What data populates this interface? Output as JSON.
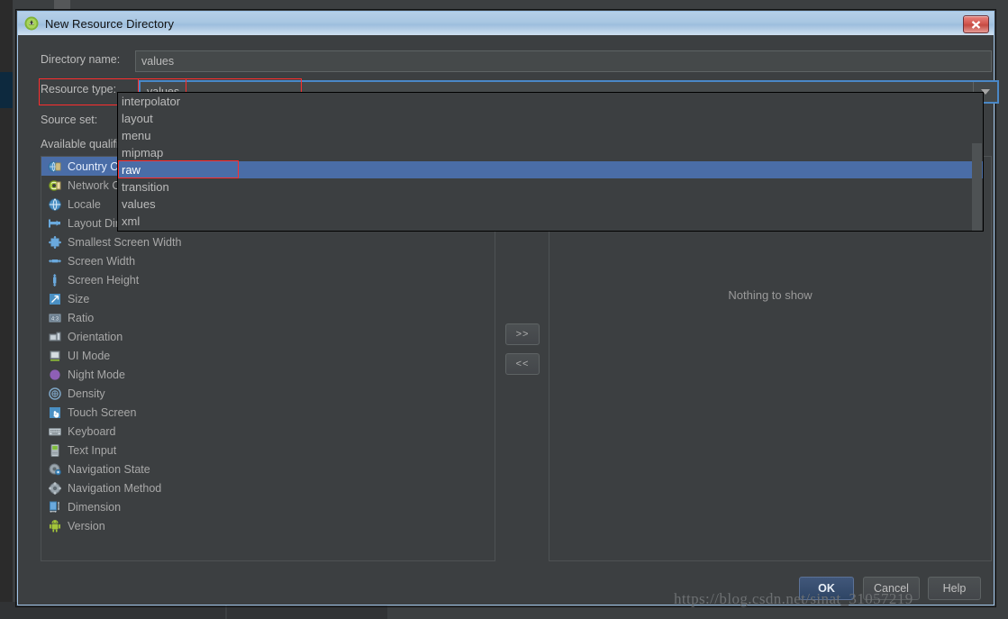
{
  "window": {
    "title": "New Resource Directory",
    "icon": "android-studio-icon",
    "close_label": "×"
  },
  "form": {
    "directory_name": {
      "label": "Directory name:",
      "value": "values"
    },
    "resource_type": {
      "label": "Resource type:",
      "value": "values"
    },
    "source_set": {
      "label": "Source set:",
      "value": ""
    },
    "available_qualifiers": {
      "label": "Available qualifiers:"
    }
  },
  "dropdown": {
    "open": true,
    "selected": "raw",
    "items": [
      "interpolator",
      "layout",
      "menu",
      "mipmap",
      "raw",
      "transition",
      "values",
      "xml"
    ]
  },
  "qualifiers": {
    "selected": "Country Code",
    "items": [
      {
        "label": "Country Code",
        "icon": "country-code-icon"
      },
      {
        "label": "Network Code",
        "icon": "network-code-icon"
      },
      {
        "label": "Locale",
        "icon": "locale-icon"
      },
      {
        "label": "Layout Direction",
        "icon": "layout-direction-icon"
      },
      {
        "label": "Smallest Screen Width",
        "icon": "smallest-screen-width-icon"
      },
      {
        "label": "Screen Width",
        "icon": "screen-width-icon"
      },
      {
        "label": "Screen Height",
        "icon": "screen-height-icon"
      },
      {
        "label": "Size",
        "icon": "size-icon"
      },
      {
        "label": "Ratio",
        "icon": "ratio-icon"
      },
      {
        "label": "Orientation",
        "icon": "orientation-icon"
      },
      {
        "label": "UI Mode",
        "icon": "ui-mode-icon"
      },
      {
        "label": "Night Mode",
        "icon": "night-mode-icon"
      },
      {
        "label": "Density",
        "icon": "density-icon"
      },
      {
        "label": "Touch Screen",
        "icon": "touch-screen-icon"
      },
      {
        "label": "Keyboard",
        "icon": "keyboard-icon"
      },
      {
        "label": "Text Input",
        "icon": "text-input-icon"
      },
      {
        "label": "Navigation State",
        "icon": "navigation-state-icon"
      },
      {
        "label": "Navigation Method",
        "icon": "navigation-method-icon"
      },
      {
        "label": "Dimension",
        "icon": "dimension-icon"
      },
      {
        "label": "Version",
        "icon": "version-icon"
      }
    ]
  },
  "transfer": {
    "add_label": ">>",
    "remove_label": "<<"
  },
  "chosen_panel": {
    "empty_text": "Nothing to show"
  },
  "footer": {
    "ok": "OK",
    "cancel": "Cancel",
    "help": "Help"
  },
  "watermark": "https://blog.csdn.net/sinat_31057219",
  "colors": {
    "dialog_bg": "#3c3f41",
    "field_bg": "#45494a",
    "selection_blue": "#4a6da7",
    "focus_border": "#4a88c7",
    "highlight_red": "#ff2d2d",
    "titlebar_blue": "#a8c6e2"
  }
}
